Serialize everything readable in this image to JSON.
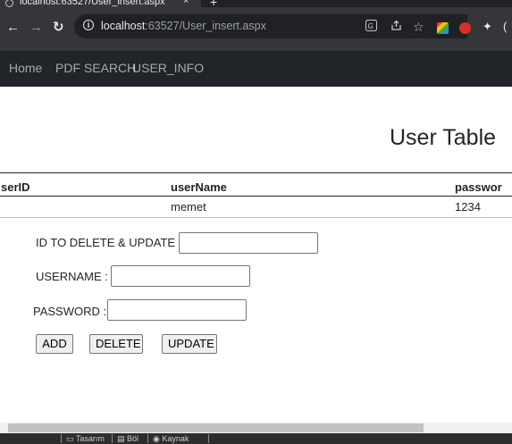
{
  "browser": {
    "tab_title": "localhost:63527/User_insert.aspx",
    "tab_close": "×",
    "new_tab": "+",
    "url_host": "localhost",
    "url_rest": ":63527/User_insert.aspx",
    "icons": {
      "back": "back-arrow-icon",
      "forward": "forward-arrow-icon",
      "reload": "reload-icon",
      "site_info": "info-icon",
      "translate": "translate-icon",
      "share": "share-icon",
      "bookmark": "star-icon",
      "extensions": "puzzle-icon"
    }
  },
  "navbar": {
    "items": [
      "Home",
      "PDF SEARCH",
      "USER_INFO"
    ]
  },
  "page": {
    "title": "User Table"
  },
  "grid": {
    "columns": [
      "serID",
      "userName",
      "passwor"
    ],
    "rows": [
      [
        "",
        "memet",
        "1234"
      ]
    ]
  },
  "form": {
    "id_label": "ID TO DELETE & UPDATE :",
    "id_value": "",
    "username_label": "USERNAME :",
    "username_value": "",
    "password_label": "PASSWORD :",
    "password_value": "",
    "add_label": "ADD",
    "delete_label": "DELETE",
    "update_label": "UPDATE"
  },
  "vs_bar": {
    "design_label": "Tasarım",
    "split_label": "Böl",
    "source_label": "Kaynak"
  },
  "colors": {
    "chrome_dark": "#202124",
    "chrome_toolbar": "#35363a",
    "navbar_bg": "#212529",
    "text": "#212529"
  }
}
